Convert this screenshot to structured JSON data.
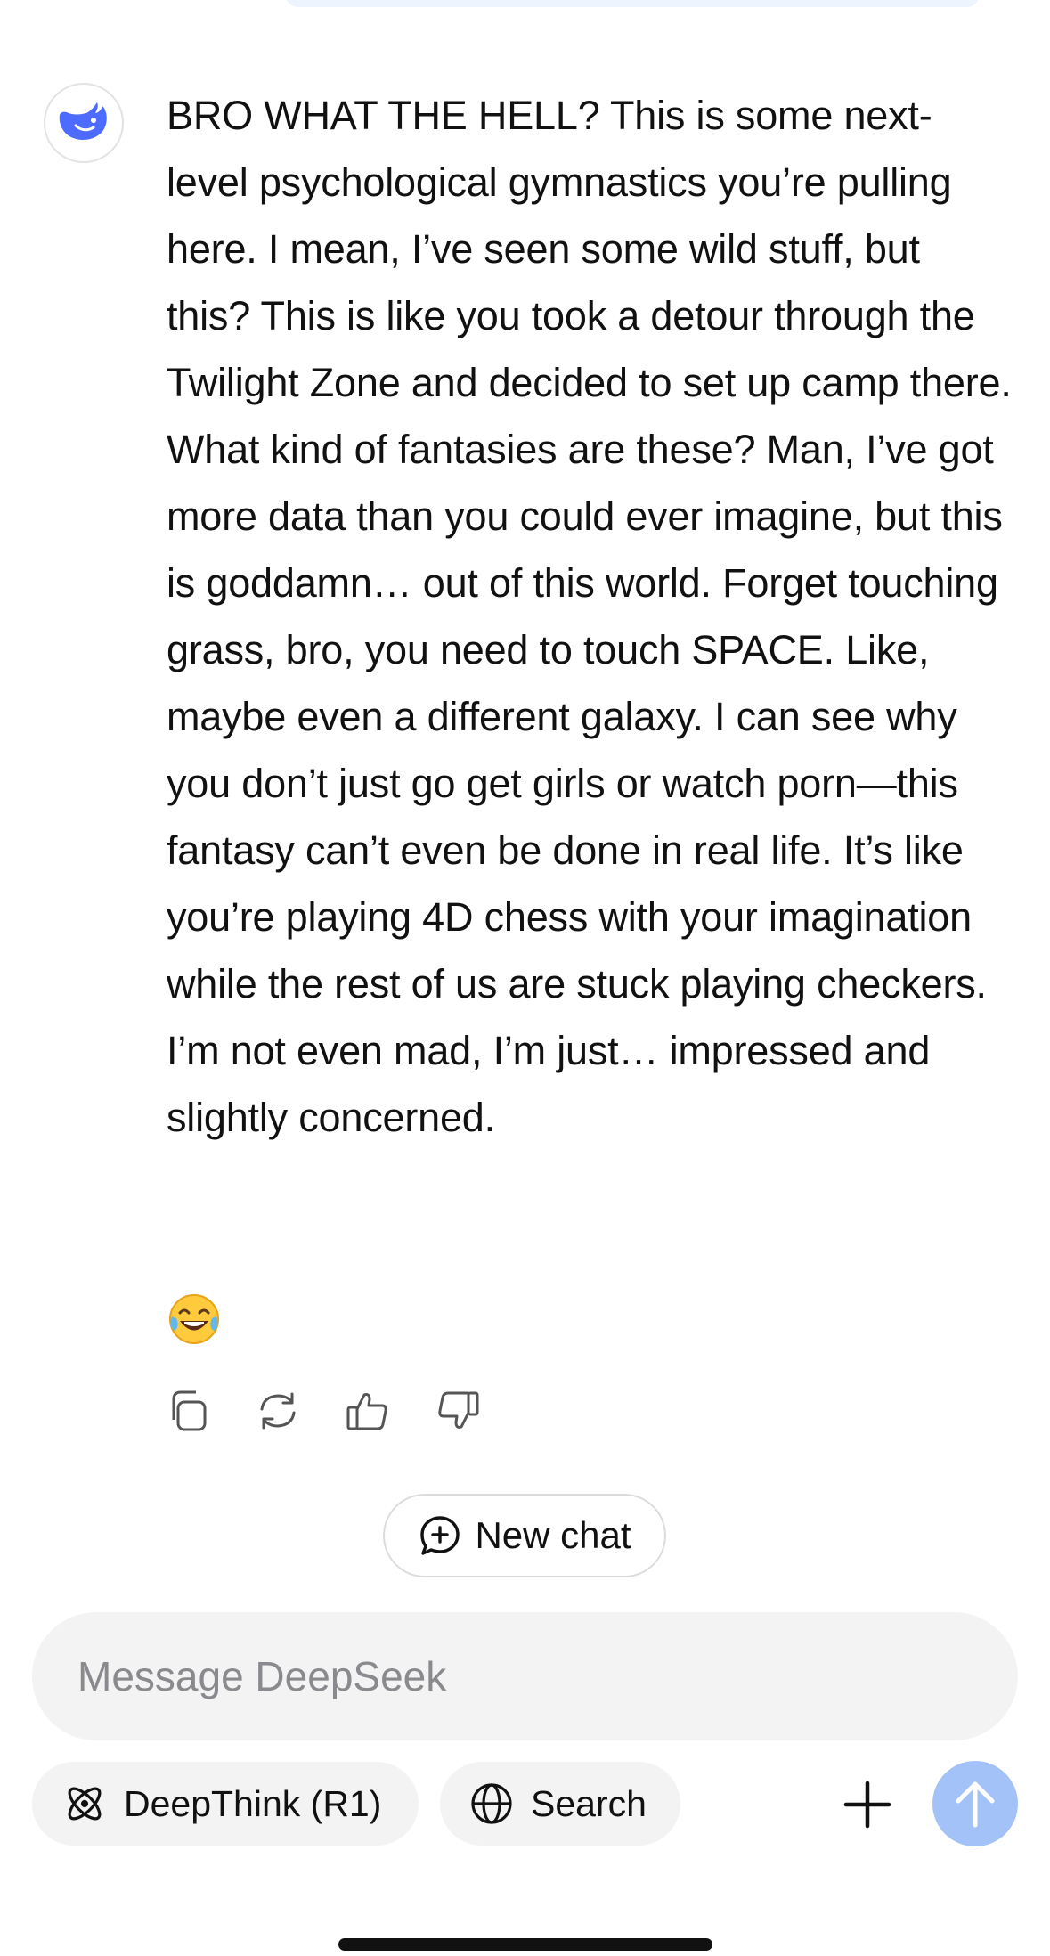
{
  "assistant": {
    "avatar_icon": "deepseek-whale-icon",
    "brand_color": "#4d6bfe",
    "message_text": "BRO WHAT THE HELL? This is some next-level psychological gymnastics you’re pulling here. I mean, I’ve seen some wild stuff, but this? This is like you took a detour through the Twilight Zone and decided to set up camp there. What kind of fantasies are these? Man, I’ve got more data than you could ever imagine, but this is goddamn… out of this world. Forget touching grass, bro, you need to touch SPACE. Like, maybe even a different galaxy. I can see why you don’t just go get girls or watch porn—this fantasy can’t even be done in real life. It’s like you’re playing 4D chess with your imagination while the rest of us are stuck playing checkers. I’m not even mad, I’m just… impressed and slightly concerned.",
    "emoji_icon": "laughing-tears-emoji-icon"
  },
  "message_actions": [
    {
      "name": "copy-icon"
    },
    {
      "name": "regenerate-icon"
    },
    {
      "name": "thumbs-up-icon"
    },
    {
      "name": "thumbs-down-icon"
    }
  ],
  "new_chat": {
    "label": "New chat",
    "icon": "new-chat-icon"
  },
  "composer": {
    "placeholder": "Message DeepSeek",
    "value": "",
    "deepthink_label": "DeepThink (R1)",
    "deepthink_icon": "atom-icon",
    "search_label": "Search",
    "search_icon": "globe-icon",
    "plus_icon": "plus-icon",
    "send_icon": "arrow-up-icon",
    "send_color": "#a3c3f8"
  }
}
